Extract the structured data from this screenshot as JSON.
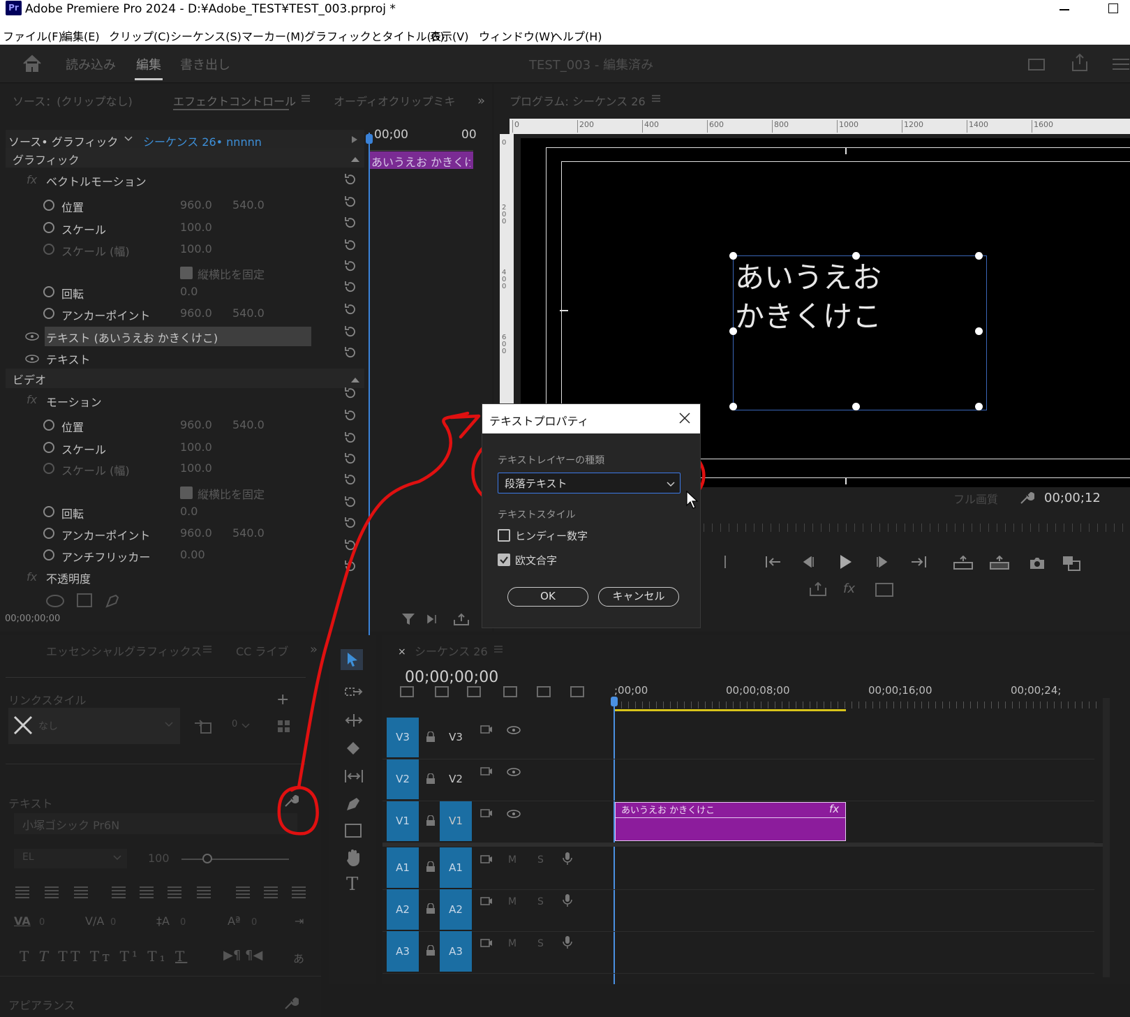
{
  "app": {
    "icon_label": "Pr",
    "title": "Adobe Premiere Pro 2024 - D:¥Adobe_TEST¥TEST_003.prproj *"
  },
  "menu": [
    "ファイル(F)",
    "編集(E)",
    "クリップ(C)",
    "シーケンス(S)",
    "マーカー(M)",
    "グラフィックとタイトル(G)",
    "表示(V)",
    "ウィンドウ(W)",
    "ヘルプ(H)"
  ],
  "workspace": {
    "tabs": [
      "読み込み",
      "編集",
      "書き出し"
    ],
    "active_tab": "編集",
    "project_title": "TEST_003 - 編集済み"
  },
  "left_panel": {
    "tabs": [
      "ソース：(クリップなし)",
      "エフェクトコントロール",
      "オーディオクリップミキ"
    ],
    "source_selector": "ソース• グラフィック",
    "sequence_selector": "シーケンス 26• nnnnn",
    "timecode_head": "00;00",
    "timecode_head_right": "00",
    "clip_label": "あいうえお かきくけ",
    "section_graphic": "グラフィック",
    "vector_motion": "ベクトルモーション",
    "rows_graphic": [
      {
        "name": "位置",
        "v1": "960.0",
        "v2": "540.0"
      },
      {
        "name": "スケール",
        "v1": "100.0",
        "v2": ""
      },
      {
        "name": "スケール (幅)",
        "v1": "100.0",
        "v2": ""
      },
      {
        "name": "縦横比を固定",
        "v1": "",
        "v2": ""
      },
      {
        "name": "回転",
        "v1": "0.0",
        "v2": ""
      },
      {
        "name": "アンカーポイント",
        "v1": "960.0",
        "v2": "540.0"
      }
    ],
    "text_layer_1": "テキスト (あいうえお かきくけこ)",
    "text_layer_2": "テキスト",
    "section_video": "ビデオ",
    "motion": "モーション",
    "rows_video": [
      {
        "name": "位置",
        "v1": "960.0",
        "v2": "540.0"
      },
      {
        "name": "スケール",
        "v1": "100.0",
        "v2": ""
      },
      {
        "name": "スケール (幅)",
        "v1": "100.0",
        "v2": ""
      },
      {
        "name": "縦横比を固定",
        "v1": "",
        "v2": ""
      },
      {
        "name": "回転",
        "v1": "0.0",
        "v2": ""
      },
      {
        "name": "アンカーポイント",
        "v1": "960.0",
        "v2": "540.0"
      },
      {
        "name": "アンチフリッカー",
        "v1": "0.00",
        "v2": ""
      }
    ],
    "opacity": "不透明度",
    "bottom_timecode": "00;00;00;00"
  },
  "program": {
    "tab": "プログラム: シーケンス 26",
    "ruler_labels": [
      "0",
      "200",
      "400",
      "600",
      "800",
      "1000",
      "1200",
      "1400",
      "1600"
    ],
    "vruler_labels": [
      "0",
      "200",
      "400",
      "600"
    ],
    "text_line1": "あいうえお",
    "text_line2": "かきくけこ",
    "quality": "フル画質",
    "timecode": "00;00;12"
  },
  "dialog": {
    "title": "テキストプロパティ",
    "layer_type_label": "テキストレイヤーの種類",
    "layer_type_value": "段落テキスト",
    "style_label": "テキストスタイル",
    "option1": "ヒンディー数字",
    "option1_checked": false,
    "option2": "欧文合字",
    "option2_checked": true,
    "ok": "OK",
    "cancel": "キャンセル"
  },
  "essential": {
    "tabs": [
      "エッセンシャルグラフィックス",
      "CC ライブ"
    ],
    "link_style": "リンクスタイル",
    "style_value": "なし",
    "zero": "0",
    "text_section": "テキスト",
    "font": "小塚ゴシック Pr6N",
    "weight": "EL",
    "size": "100",
    "tracking_vals": [
      "0",
      "0",
      "0",
      "0"
    ],
    "appearance": "アピアランス"
  },
  "timeline": {
    "tab": "シーケンス 26",
    "timecode": "00;00;00;00",
    "ruler": [
      ";00;00",
      "00;00;08;00",
      "00;00;16;00",
      "00;00;24;"
    ],
    "video_tracks": [
      "V3",
      "V2",
      "V1"
    ],
    "audio_tracks": [
      "A1",
      "A2",
      "A3"
    ],
    "mute": "M",
    "solo": "S",
    "clip_label": "あいうえお かきくけこ",
    "clip_fx": "fx"
  },
  "colors": {
    "clip": "#8c1c9c",
    "track_blue": "#1b6ea3",
    "annotation": "#e01010",
    "playhead": "#4a90e2"
  }
}
